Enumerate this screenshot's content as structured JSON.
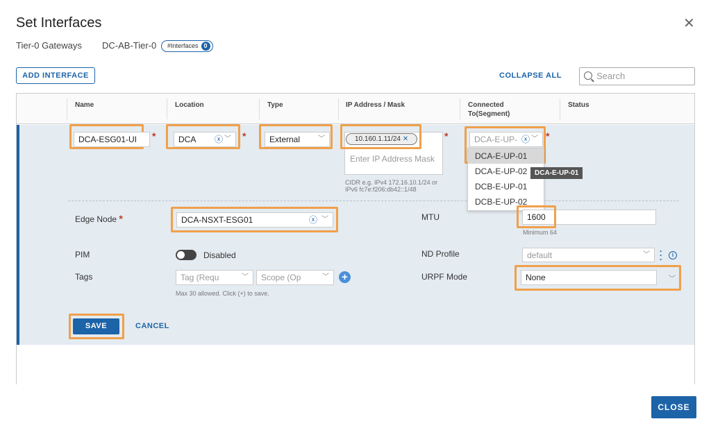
{
  "dialog": {
    "title": "Set Interfaces",
    "close_icon": "close-icon",
    "breadcrumb_parent": "Tier-0 Gateways",
    "breadcrumb_gateway": "DC-AB-Tier-0",
    "interfaces_pill_label": "#Interfaces",
    "interfaces_count": "0"
  },
  "toolbar": {
    "add_interface": "ADD INTERFACE",
    "collapse_all": "COLLAPSE ALL",
    "search_placeholder": "Search"
  },
  "columns": [
    "Name",
    "Location",
    "Type",
    "IP Address / Mask",
    "Connected To(Segment)",
    "Status"
  ],
  "columns_connected_line1": "Connected",
  "columns_connected_line2": "To(Segment)",
  "form": {
    "name_value": "DCA-ESG01-UI",
    "location_value": "DCA",
    "type_value": "External",
    "ip_tag": "10.160.1.11/24",
    "ip_placeholder": "Enter IP Address Mask",
    "ip_hint_line1": "CIDR e.g. IPv4 172.16.10.1/24 or",
    "ip_hint_line2": "IPv6 fc7e:f206:db42::1/48",
    "segment_value": "DCA-E-UP-",
    "segment_options": [
      "DCA-E-UP-01",
      "DCA-E-UP-02",
      "DCB-E-UP-01",
      "DCB-E-UP-02"
    ],
    "segment_selected": "DCA-E-UP-01",
    "tooltip": "DCA-E-UP-01",
    "edge_node_label": "Edge Node",
    "edge_node_value": "DCA-NSXT-ESG01",
    "mtu_label": "MTU",
    "mtu_value": "1600",
    "mtu_hint": "Minimum 64",
    "pim_label": "PIM",
    "pim_state": "Disabled",
    "nd_profile_label": "ND Profile",
    "nd_profile_value": "default",
    "tags_label": "Tags",
    "tag_placeholder": "Tag (Requ",
    "scope_placeholder": "Scope (Op",
    "tags_hint": "Max 30 allowed. Click (+) to save.",
    "urpf_label": "URPF Mode",
    "urpf_value": "None",
    "save": "SAVE",
    "cancel": "CANCEL"
  },
  "footer": {
    "close": "CLOSE"
  },
  "colors": {
    "accent": "#1d63a8",
    "highlight": "#f0a04b",
    "panel": "#e4ebf1",
    "required": "#c0392b"
  }
}
